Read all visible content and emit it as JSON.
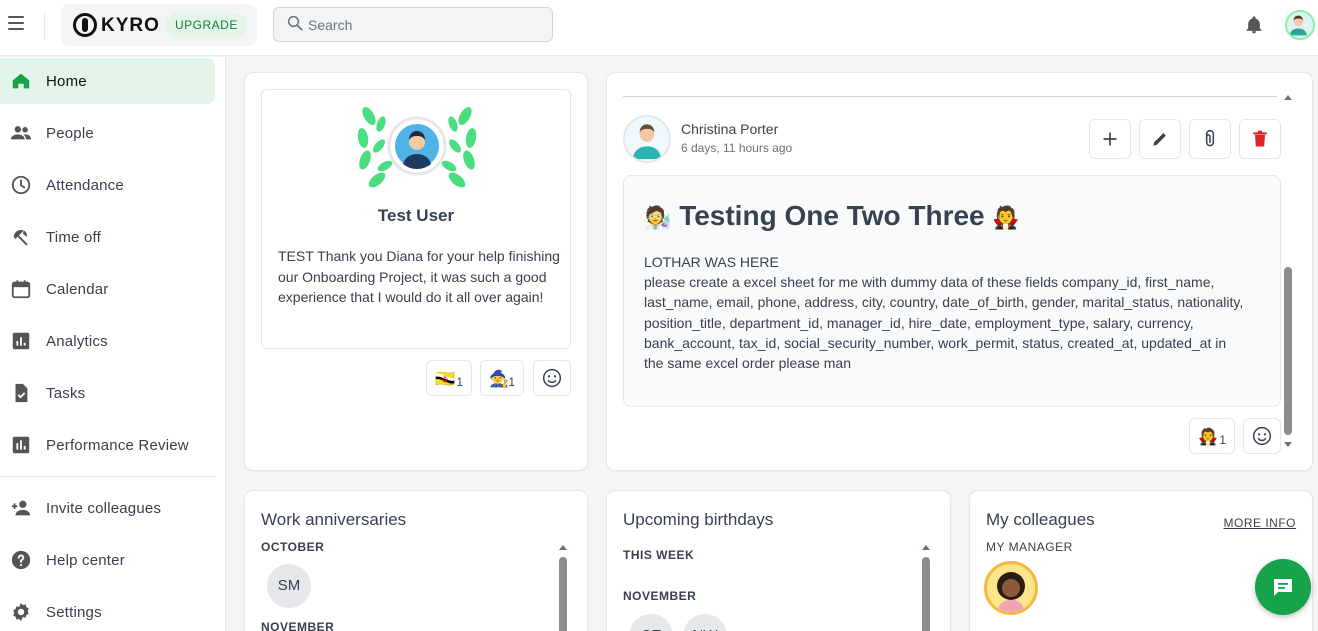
{
  "topbar": {
    "logo_text": "KYRO",
    "upgrade_label": "UPGRADE",
    "search_placeholder": "Search"
  },
  "sidebar": {
    "items": [
      {
        "label": "Home",
        "icon": "home-icon",
        "active": true
      },
      {
        "label": "People",
        "icon": "people-icon"
      },
      {
        "label": "Attendance",
        "icon": "clock-icon"
      },
      {
        "label": "Time off",
        "icon": "beach-umbrella-icon"
      },
      {
        "label": "Calendar",
        "icon": "calendar-icon"
      },
      {
        "label": "Analytics",
        "icon": "analytics-icon"
      },
      {
        "label": "Tasks",
        "icon": "task-clipboard-icon"
      },
      {
        "label": "Performance Review",
        "icon": "bar-chart-icon"
      }
    ],
    "bottom_items": [
      {
        "label": "Invite colleagues",
        "icon": "person-add-icon"
      },
      {
        "label": "Help center",
        "icon": "help-icon"
      },
      {
        "label": "Settings",
        "icon": "gear-icon"
      }
    ]
  },
  "kudos": {
    "name": "Test User",
    "message": "TEST Thank you Diana for your help finishing our Onboarding Project, it was such a good experience that I would do it all over again!",
    "reactions": [
      {
        "emoji": "🇧🇳",
        "count": "1"
      },
      {
        "emoji": "🧙",
        "count": "1"
      }
    ]
  },
  "post": {
    "author": "Christina Porter",
    "time": "6 days, 11 hours ago",
    "title_emoji_left": "🧑‍🔬",
    "title": "Testing One Two Three",
    "title_emoji_right": "🧛",
    "line1": "LOTHAR WAS HERE",
    "body": "please create a excel sheet for me with dummy data of these fields company_id, first_name, last_name, email, phone, address, city, country, date_of_birth, gender, marital_status, nationality, position_title, department_id, manager_id, hire_date, employment_type, salary, currency, bank_account, tax_id, social_security_number, work_permit, status, created_at, updated_at in the same excel order please man",
    "reaction": {
      "emoji": "🧛",
      "count": "1"
    }
  },
  "anniversaries": {
    "title": "Work anniversaries",
    "month1": "OCTOBER",
    "person1": "SM",
    "month2": "NOVEMBER"
  },
  "birthdays": {
    "title": "Upcoming birthdays",
    "this_week": "THIS WEEK",
    "month": "NOVEMBER",
    "persons": [
      "CE",
      "NW"
    ]
  },
  "colleagues": {
    "title": "My colleagues",
    "more_info": "MORE INFO",
    "manager_label": "MY MANAGER"
  },
  "colors": {
    "accent": "#16a34a",
    "active_bg": "#e3f4e9",
    "delete": "#dc2626"
  }
}
